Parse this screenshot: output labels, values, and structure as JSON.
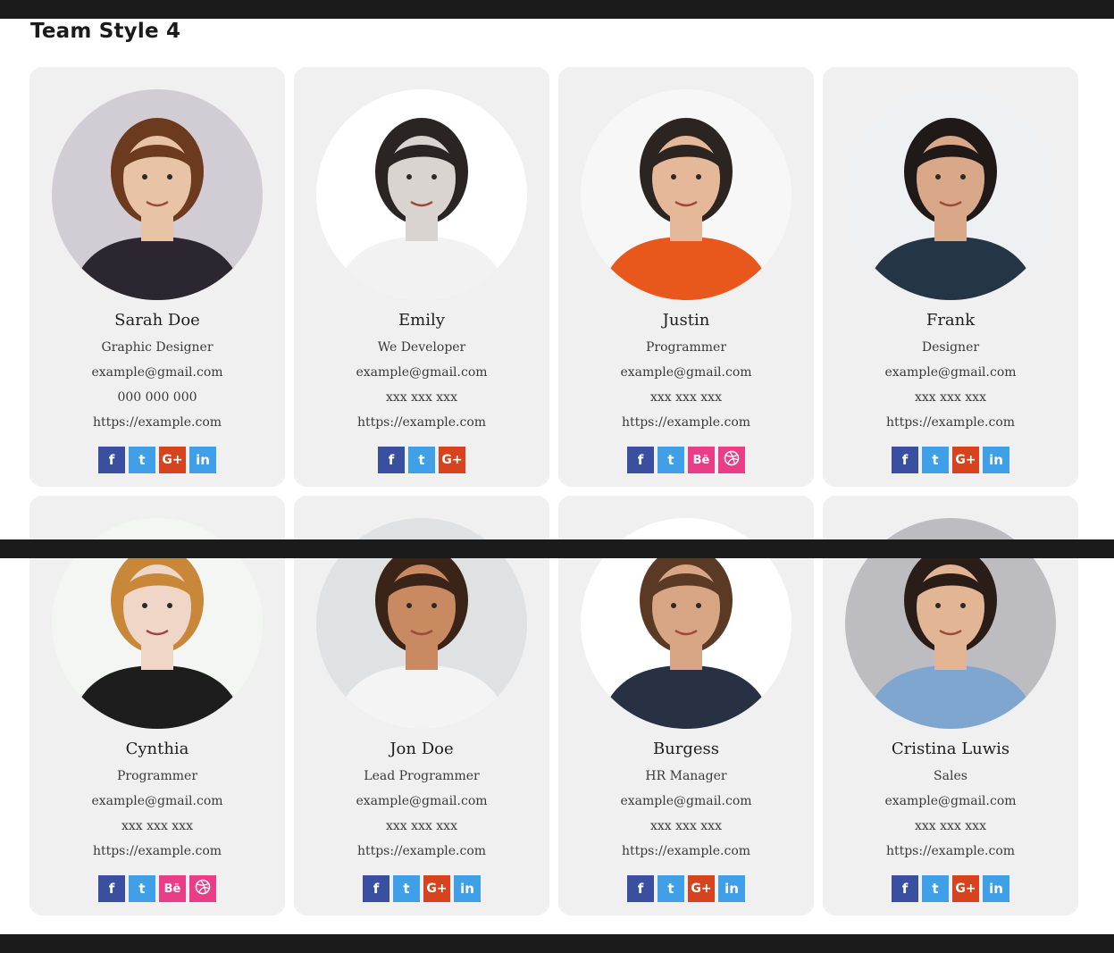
{
  "page": {
    "title": "Team Style 4"
  },
  "members": [
    {
      "name": "Sarah Doe",
      "role": "Graphic Designer",
      "email": "example@gmail.com",
      "phone": "000 000 000",
      "url": "https://example.com",
      "social": [
        "facebook",
        "twitter",
        "googleplus",
        "linkedin"
      ],
      "photo": {
        "bg": "#d2ccd4",
        "skin": "#e8c3a6",
        "hair": "#6b3a1f",
        "shirt": "#2c2630"
      }
    },
    {
      "name": "Emily",
      "role": "We Developer",
      "email": "example@gmail.com",
      "phone": "xxx xxx xxx",
      "url": "https://example.com",
      "social": [
        "facebook",
        "twitter",
        "googleplus"
      ],
      "photo": {
        "bg": "#ffffff",
        "skin": "#d9d4d0",
        "hair": "#2a2522",
        "shirt": "#f2f2f2"
      }
    },
    {
      "name": "Justin",
      "role": "Programmer",
      "email": "example@gmail.com",
      "phone": "xxx xxx xxx",
      "url": "https://example.com",
      "social": [
        "facebook",
        "twitter",
        "behance",
        "dribbble"
      ],
      "photo": {
        "bg": "#f7f7f7",
        "skin": "#e4b899",
        "hair": "#2b2420",
        "shirt": "#e8581c"
      }
    },
    {
      "name": "Frank",
      "role": "Designer",
      "email": "example@gmail.com",
      "phone": "xxx xxx xxx",
      "url": "https://example.com",
      "social": [
        "facebook",
        "twitter",
        "googleplus",
        "linkedin"
      ],
      "photo": {
        "bg": "#eef1f3",
        "skin": "#d8a889",
        "hair": "#1f1a18",
        "shirt": "#243645"
      }
    },
    {
      "name": "Cynthia",
      "role": "Programmer",
      "email": "example@gmail.com",
      "phone": "xxx xxx xxx",
      "url": "https://example.com",
      "social": [
        "facebook",
        "twitter",
        "behance",
        "dribbble"
      ],
      "photo": {
        "bg": "#f4f6f4",
        "skin": "#f0d6c6",
        "hair": "#c9873a",
        "shirt": "#1d1d1d"
      }
    },
    {
      "name": "Jon Doe",
      "role": "Lead Programmer",
      "email": "example@gmail.com",
      "phone": "xxx xxx xxx",
      "url": "https://example.com",
      "social": [
        "facebook",
        "twitter",
        "googleplus",
        "linkedin"
      ],
      "photo": {
        "bg": "#dfe1e3",
        "skin": "#c98a62",
        "hair": "#3a2418",
        "shirt": "#f4f4f4"
      }
    },
    {
      "name": "Burgess",
      "role": "HR Manager",
      "email": "example@gmail.com",
      "phone": "xxx xxx xxx",
      "url": "https://example.com",
      "social": [
        "facebook",
        "twitter",
        "googleplus",
        "linkedin"
      ],
      "photo": {
        "bg": "#ffffff",
        "skin": "#d9a685",
        "hair": "#5a3a24",
        "shirt": "#273143"
      }
    },
    {
      "name": "Cristina Luwis",
      "role": "Sales",
      "email": "example@gmail.com",
      "phone": "xxx xxx xxx",
      "url": "https://example.com",
      "social": [
        "facebook",
        "twitter",
        "googleplus",
        "linkedin"
      ],
      "photo": {
        "bg": "#bdbcc0",
        "skin": "#e2b595",
        "hair": "#2a1d17",
        "shirt": "#7fa6cf"
      }
    }
  ],
  "social_glyphs": {
    "facebook": "f",
    "twitter": "t",
    "googleplus": "G+",
    "linkedin": "in",
    "behance": "Bē",
    "dribbble": ""
  },
  "colors": {
    "facebook": "#3b4fa0",
    "twitter": "#3fa0e8",
    "googleplus": "#d8431f",
    "linkedin": "#3fa0e8",
    "behance": "#ea3d88",
    "dribbble": "#ea3d88",
    "card_bg": "#f0f0f0",
    "bar": "#1b1b1b"
  }
}
